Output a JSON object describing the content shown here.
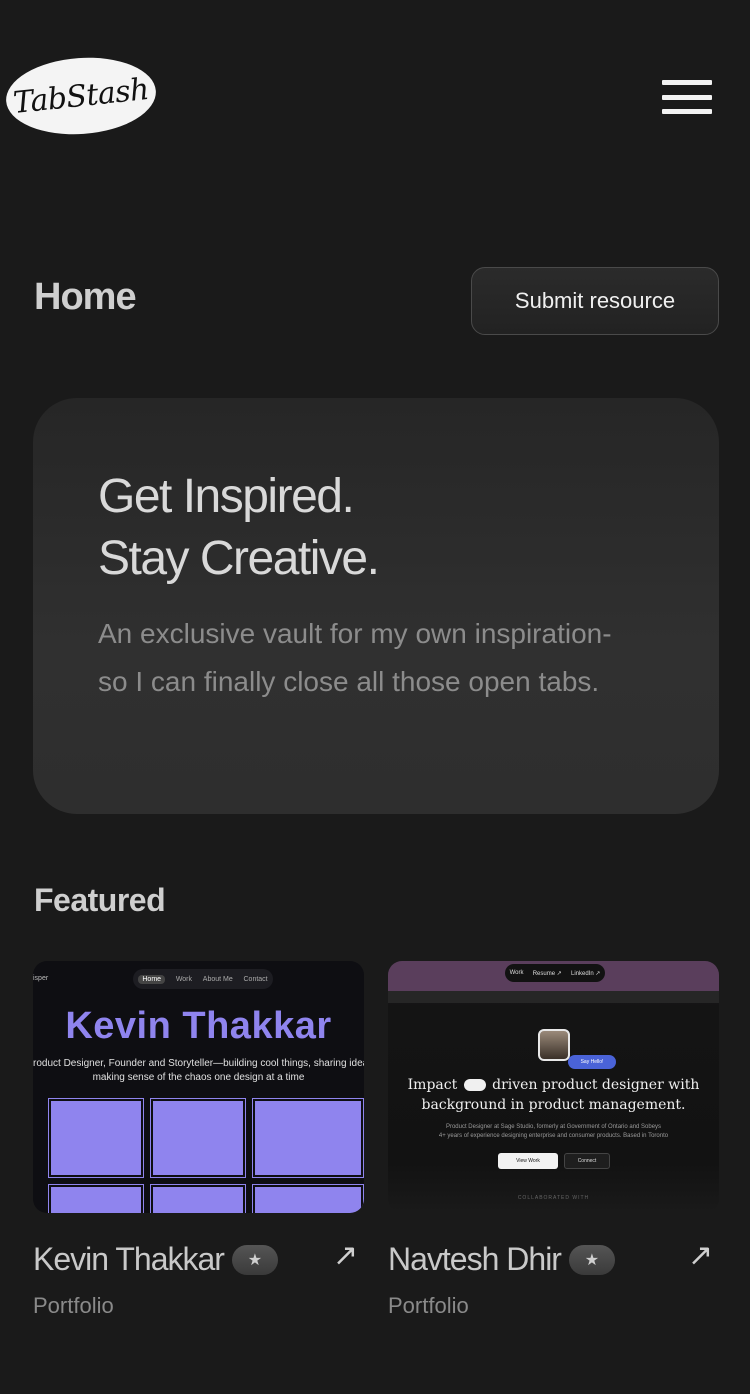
{
  "header": {
    "logo_text": "TabStash",
    "menu_icon": "hamburger-menu-icon"
  },
  "page": {
    "title": "Home",
    "submit_label": "Submit resource"
  },
  "hero": {
    "line1": "Get Inspired.",
    "line2": "Stay Creative.",
    "description": "An exclusive vault for my own inspiration-so I can finally close all those open tabs."
  },
  "featured": {
    "title": "Featured",
    "items": [
      {
        "name": "Kevin Thakkar",
        "badge_icon": "star-icon",
        "badge": "★",
        "arrow": "↗",
        "category": "Portfolio",
        "preview": {
          "corner": "isper",
          "nav": [
            "Home",
            "Work",
            "About Me",
            "Contact"
          ],
          "title": "Kevin Thakkar",
          "subtitle_line1": "roduct Designer, Founder and Storyteller—building cool things, sharing ideas, a",
          "subtitle_line2": "making sense of the chaos one design at a time",
          "accent": "#8f84ee"
        }
      },
      {
        "name": "Navtesh Dhir",
        "badge_icon": "star-icon",
        "badge": "★",
        "arrow": "↗",
        "category": "Portfolio",
        "preview": {
          "nav": [
            "Work",
            "Resume ↗",
            "LinkedIn ↗"
          ],
          "tag": "Say Hello!",
          "headline_part1": "Impact",
          "headline_part2": "driven product designer with",
          "headline_line2": "background in product management.",
          "desc_line1": "Product Designer at Sage Studio, formerly at Government of Ontario and Sobeys",
          "desc_line2": "4+ years of experience designing enterprise and consumer products. Based in Toronto",
          "btn1": "View Work",
          "btn2": "Connect",
          "footer": "COLLABORATED WITH",
          "accent": "#4a63d8"
        }
      }
    ]
  }
}
